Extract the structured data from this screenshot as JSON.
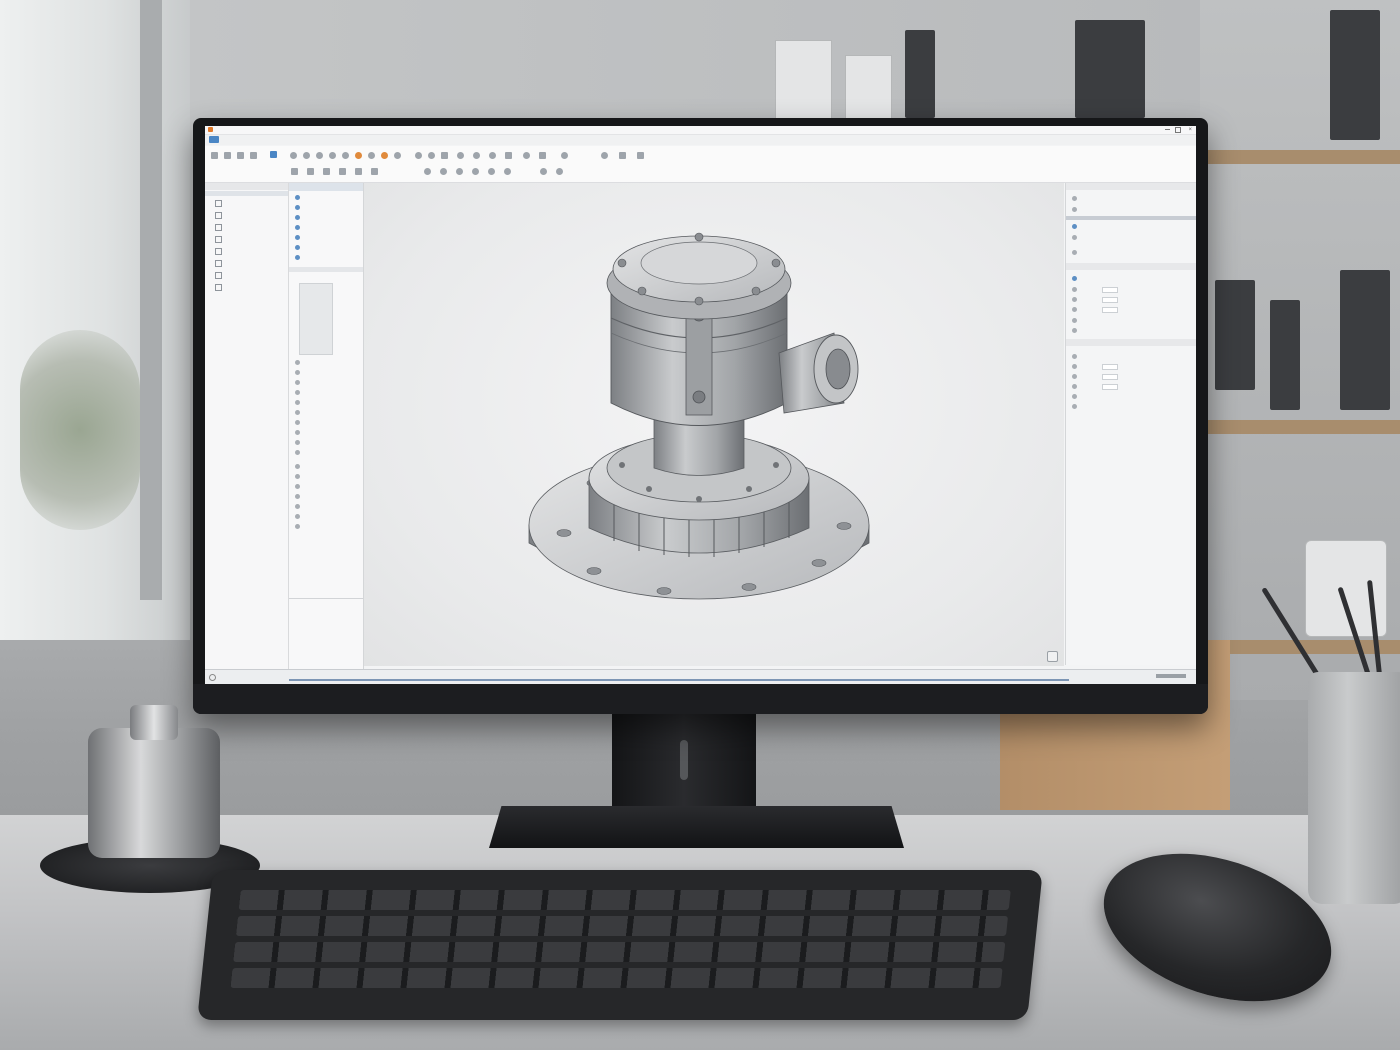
{
  "app": {
    "title": "",
    "logo_text": ""
  },
  "menu_tabs": [
    "",
    "",
    "",
    "",
    "",
    "",
    "",
    "",
    "",
    "",
    "",
    "",
    ""
  ],
  "ribbon": {
    "group_labels": []
  },
  "left_nav": {
    "items": []
  },
  "tree": {
    "header": "",
    "rows": []
  },
  "right_panel": {
    "sections": []
  },
  "colors": {
    "accent": "#4a86c5",
    "highlight": "#e08a3c",
    "ui_background": "#f3f4f5",
    "model_grey": "#a7a9ac",
    "monitor_bezel": "#161719"
  },
  "icons": [
    "app-logo-icon",
    "window-min-icon",
    "window-max-icon",
    "window-close-icon",
    "view-cube-icon"
  ]
}
